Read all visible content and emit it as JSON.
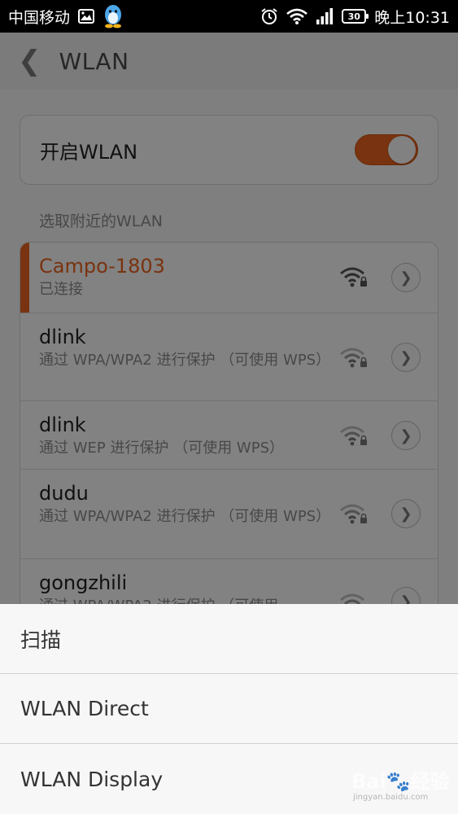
{
  "statusbar": {
    "carrier": "中国移动",
    "battery": "30",
    "time": "晚上10:31"
  },
  "actionbar": {
    "back_icon": "chevron-left-icon",
    "title": "WLAN"
  },
  "toggle": {
    "label": "开启WLAN",
    "on": true,
    "accent": "#e8621f"
  },
  "section": {
    "label": "选取附近的WLAN"
  },
  "networks": [
    {
      "name": "Campo-1803",
      "status": "已连接",
      "active": true
    },
    {
      "name": "dlink",
      "status": "通过 WPA/WPA2 进行保护 （可使用 WPS）",
      "active": false
    },
    {
      "name": "dlink",
      "status": "通过 WEP 进行保护 （可使用 WPS）",
      "active": false
    },
    {
      "name": "dudu",
      "status": "通过 WPA/WPA2 进行保护 （可使用 WPS）",
      "active": false
    },
    {
      "name": "gongzhili",
      "status": "通过 WPA/WPA2 进行保护 （可使用",
      "active": false
    }
  ],
  "menu": {
    "items": [
      "扫描",
      "WLAN Direct",
      "WLAN Display"
    ]
  },
  "watermark": {
    "text": "Bai🐾经验",
    "sub": "jingyan.baidu.com"
  }
}
